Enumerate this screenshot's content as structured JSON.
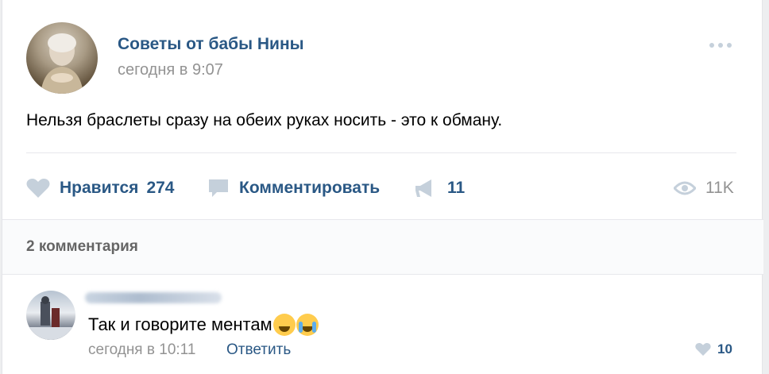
{
  "post": {
    "author": "Советы от бабы Нины",
    "date": "сегодня в 9:07",
    "text": "Нельзя браслеты сразу на обеих руках носить - это к обману.",
    "more_icon": "more-dots-icon"
  },
  "actions": {
    "like_label": "Нравится",
    "like_count": "274",
    "comment_label": "Комментировать",
    "share_count": "11",
    "views_count": "11K"
  },
  "comments": {
    "count_label": "2 комментария",
    "items": [
      {
        "text": "Так и говорите ментам",
        "emojis": [
          "rofl-emoji-icon",
          "crying-emoji-icon"
        ],
        "date": "сегодня в 10:11",
        "reply_label": "Ответить",
        "like_count": "10"
      }
    ]
  },
  "colors": {
    "link": "#2a5885",
    "muted": "#939393",
    "icon": "#c5d0db",
    "background": "#edeef0"
  }
}
